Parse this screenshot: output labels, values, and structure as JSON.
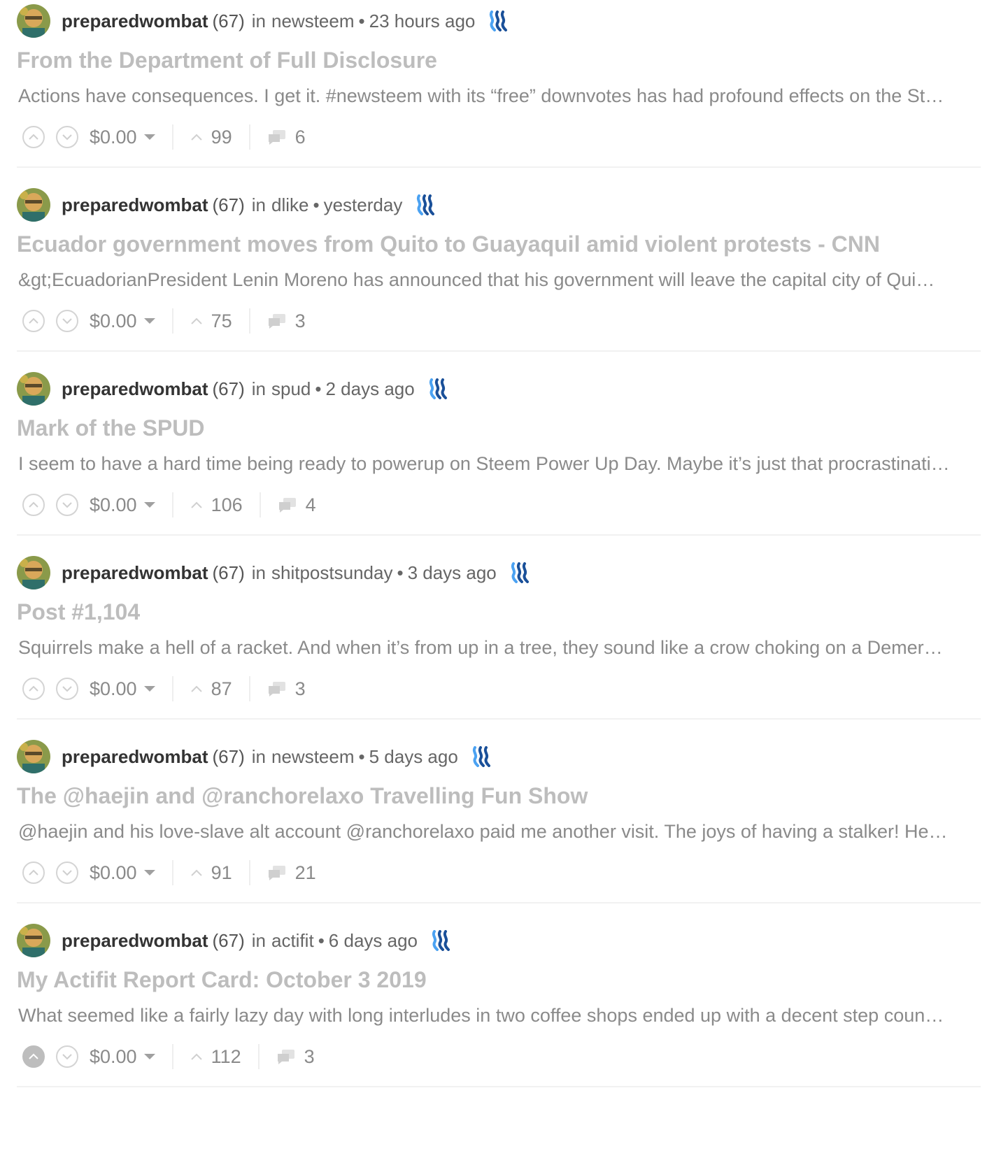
{
  "posts": [
    {
      "author": "preparedwombat",
      "rep": "(67)",
      "in_label": "in",
      "tag": "newsteem",
      "bullet": "•",
      "time": "23 hours ago",
      "title": "From the Department of Full Disclosure",
      "excerpt": "Actions have consequences. I get it. #newsteem with its “free” downvotes has had profound effects on the St…",
      "payout": "$0.00",
      "votes": "99",
      "comments": "6"
    },
    {
      "author": "preparedwombat",
      "rep": "(67)",
      "in_label": "in",
      "tag": "dlike",
      "bullet": "•",
      "time": "yesterday",
      "title": "Ecuador government moves from Quito to Guayaquil amid violent protests - CNN",
      "excerpt": "&gt;EcuadorianPresident Lenin Moreno has announced that his government will leave the capital city of Qui…",
      "payout": "$0.00",
      "votes": "75",
      "comments": "3"
    },
    {
      "author": "preparedwombat",
      "rep": "(67)",
      "in_label": "in",
      "tag": "spud",
      "bullet": "•",
      "time": "2 days ago",
      "title": "Mark of the SPUD",
      "excerpt": "I seem to have a hard time being ready to powerup on Steem Power Up Day. Maybe it’s just that procrastinati…",
      "payout": "$0.00",
      "votes": "106",
      "comments": "4"
    },
    {
      "author": "preparedwombat",
      "rep": "(67)",
      "in_label": "in",
      "tag": "shitpostsunday",
      "bullet": "•",
      "time": "3 days ago",
      "title": "Post #1,104",
      "excerpt": "Squirrels make a hell of a racket. And when it’s from up in a tree, they sound like a crow choking on a Demer…",
      "payout": "$0.00",
      "votes": "87",
      "comments": "3"
    },
    {
      "author": "preparedwombat",
      "rep": "(67)",
      "in_label": "in",
      "tag": "newsteem",
      "bullet": "•",
      "time": "5 days ago",
      "title": "The @haejin and @ranchorelaxo Travelling Fun Show",
      "excerpt": "@haejin and his love-slave alt account @ranchorelaxo paid me another visit. The joys of having a stalker! He…",
      "payout": "$0.00",
      "votes": "91",
      "comments": "21"
    },
    {
      "author": "preparedwombat",
      "rep": "(67)",
      "in_label": "in",
      "tag": "actifit",
      "bullet": "•",
      "time": "6 days ago",
      "title": "My Actifit Report Card: October 3 2019",
      "excerpt": "What seemed like a fairly lazy day with long interludes in two coffee shops ended up with a decent step coun…",
      "payout": "$0.00",
      "votes": "112",
      "comments": "3"
    }
  ],
  "icons": {
    "steem": "steem-logo-icon",
    "upvote": "upvote-chevron-icon",
    "downvote": "downvote-chevron-icon",
    "votes": "votes-chevron-icon",
    "comments": "comments-bubble-icon",
    "caret": "dropdown-caret-icon"
  },
  "colors": {
    "steem_blue": "#1a5099",
    "steem_light_blue": "#4ba2f2",
    "title_gray": "#bdbdbd",
    "text_gray": "#8a8a8a"
  },
  "upvoted_post_index": 5
}
